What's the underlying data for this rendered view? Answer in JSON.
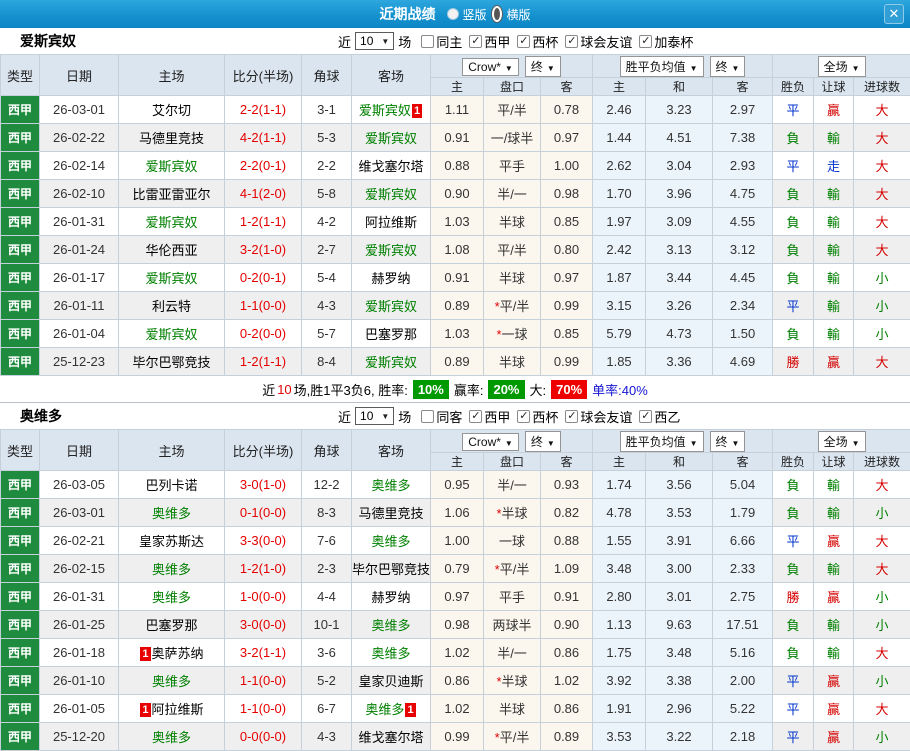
{
  "titlebar": {
    "title": "近期战绩",
    "radios": [
      {
        "label": "竖版",
        "selected": false
      },
      {
        "label": "横版",
        "selected": true
      }
    ],
    "close_glyph": "✕"
  },
  "table_header": {
    "left_cols": [
      "类型",
      "日期",
      "主场",
      "比分(半场)",
      "角球",
      "客场"
    ],
    "groups": [
      {
        "dropdowns": [
          "Crow*",
          "终"
        ],
        "cols": [
          "主",
          "盘口",
          "客"
        ]
      },
      {
        "dropdowns": [
          "胜平负均值",
          "终"
        ],
        "cols": [
          "主",
          "和",
          "客"
        ]
      },
      {
        "dropdowns": [
          "全场"
        ],
        "cols": [
          "胜负",
          "让球",
          "进球数"
        ]
      }
    ],
    "dropdown_arrow": "▼",
    "check_glyph": "✓"
  },
  "sections": [
    {
      "team": "爱斯宾奴",
      "near_label": "近",
      "count_value": "10",
      "count_suffix": "场",
      "filters": [
        {
          "label": "同主",
          "checked": false
        },
        {
          "label": "西甲",
          "checked": true
        },
        {
          "label": "西杯",
          "checked": true
        },
        {
          "label": "球会友谊",
          "checked": true
        },
        {
          "label": "加泰杯",
          "checked": true
        }
      ],
      "rows": [
        {
          "league": "西甲",
          "date": "26-03-01",
          "home": "艾尔切",
          "home_is_team": false,
          "home_badge": "",
          "score": "2-2(1-1)",
          "corners": "3-1",
          "away": "爱斯宾奴",
          "away_is_team": true,
          "away_badge": "1",
          "odds": [
            "1.11",
            "平/半",
            "0.78"
          ],
          "means": [
            "2.46",
            "3.23",
            "2.97"
          ],
          "results": [
            "平",
            "贏",
            "大"
          ]
        },
        {
          "league": "西甲",
          "date": "26-02-22",
          "home": "马德里竞技",
          "home_is_team": false,
          "home_badge": "",
          "score": "4-2(1-1)",
          "corners": "5-3",
          "away": "爱斯宾奴",
          "away_is_team": true,
          "away_badge": "",
          "odds": [
            "0.91",
            "一/球半",
            "0.97"
          ],
          "means": [
            "1.44",
            "4.51",
            "7.38"
          ],
          "results": [
            "負",
            "輸",
            "大"
          ]
        },
        {
          "league": "西甲",
          "date": "26-02-14",
          "home": "爱斯宾奴",
          "home_is_team": true,
          "home_badge": "",
          "score": "2-2(0-1)",
          "corners": "2-2",
          "away": "维戈塞尔塔",
          "away_is_team": false,
          "away_badge": "",
          "odds": [
            "0.88",
            "平手",
            "1.00"
          ],
          "means": [
            "2.62",
            "3.04",
            "2.93"
          ],
          "results": [
            "平",
            "走",
            "大"
          ]
        },
        {
          "league": "西甲",
          "date": "26-02-10",
          "home": "比雷亚雷亚尔",
          "home_is_team": false,
          "home_badge": "",
          "score": "4-1(2-0)",
          "corners": "5-8",
          "away": "爱斯宾奴",
          "away_is_team": true,
          "away_badge": "",
          "odds": [
            "0.90",
            "半/一",
            "0.98"
          ],
          "means": [
            "1.70",
            "3.96",
            "4.75"
          ],
          "results": [
            "負",
            "輸",
            "大"
          ]
        },
        {
          "league": "西甲",
          "date": "26-01-31",
          "home": "爱斯宾奴",
          "home_is_team": true,
          "home_badge": "",
          "score": "1-2(1-1)",
          "corners": "4-2",
          "away": "阿拉维斯",
          "away_is_team": false,
          "away_badge": "",
          "odds": [
            "1.03",
            "半球",
            "0.85"
          ],
          "means": [
            "1.97",
            "3.09",
            "4.55"
          ],
          "results": [
            "負",
            "輸",
            "大"
          ]
        },
        {
          "league": "西甲",
          "date": "26-01-24",
          "home": "华伦西亚",
          "home_is_team": false,
          "home_badge": "",
          "score": "3-2(1-0)",
          "corners": "2-7",
          "away": "爱斯宾奴",
          "away_is_team": true,
          "away_badge": "",
          "odds": [
            "1.08",
            "平/半",
            "0.80"
          ],
          "means": [
            "2.42",
            "3.13",
            "3.12"
          ],
          "results": [
            "負",
            "輸",
            "大"
          ]
        },
        {
          "league": "西甲",
          "date": "26-01-17",
          "home": "爱斯宾奴",
          "home_is_team": true,
          "home_badge": "",
          "score": "0-2(0-1)",
          "corners": "5-4",
          "away": "赫罗纳",
          "away_is_team": false,
          "away_badge": "",
          "odds": [
            "0.91",
            "半球",
            "0.97"
          ],
          "means": [
            "1.87",
            "3.44",
            "4.45"
          ],
          "results": [
            "負",
            "輸",
            "小"
          ]
        },
        {
          "league": "西甲",
          "date": "26-01-11",
          "home": "利云特",
          "home_is_team": false,
          "home_badge": "",
          "score": "1-1(0-0)",
          "corners": "4-3",
          "away": "爱斯宾奴",
          "away_is_team": true,
          "away_badge": "",
          "odds": [
            "0.89",
            "*平/半",
            "0.99"
          ],
          "means": [
            "3.15",
            "3.26",
            "2.34"
          ],
          "results": [
            "平",
            "輸",
            "小"
          ]
        },
        {
          "league": "西甲",
          "date": "26-01-04",
          "home": "爱斯宾奴",
          "home_is_team": true,
          "home_badge": "",
          "score": "0-2(0-0)",
          "corners": "5-7",
          "away": "巴塞罗那",
          "away_is_team": false,
          "away_badge": "",
          "odds": [
            "1.03",
            "*一球",
            "0.85"
          ],
          "means": [
            "5.79",
            "4.73",
            "1.50"
          ],
          "results": [
            "負",
            "輸",
            "小"
          ]
        },
        {
          "league": "西甲",
          "date": "25-12-23",
          "home": "毕尔巴鄂竞技",
          "home_is_team": false,
          "home_badge": "",
          "score": "1-2(1-1)",
          "corners": "8-4",
          "away": "爱斯宾奴",
          "away_is_team": true,
          "away_badge": "",
          "odds": [
            "0.89",
            "半球",
            "0.99"
          ],
          "means": [
            "1.85",
            "3.36",
            "4.69"
          ],
          "results": [
            "勝",
            "贏",
            "大"
          ]
        }
      ],
      "summary": [
        {
          "t": "近",
          "s": "plain"
        },
        {
          "t": "10",
          "s": "red"
        },
        {
          "t": "场,胜1平3负6, 胜率:",
          "s": "plain"
        },
        {
          "t": "10%",
          "s": "badge-green"
        },
        {
          "t": "赢率:",
          "s": "plain"
        },
        {
          "t": "20%",
          "s": "badge-green"
        },
        {
          "t": "大:",
          "s": "plain"
        },
        {
          "t": "70%",
          "s": "badge-red"
        },
        {
          "t": "单率:40%",
          "s": "blue"
        }
      ]
    },
    {
      "team": "奥维多",
      "near_label": "近",
      "count_value": "10",
      "count_suffix": "场",
      "filters": [
        {
          "label": "同客",
          "checked": false
        },
        {
          "label": "西甲",
          "checked": true
        },
        {
          "label": "西杯",
          "checked": true
        },
        {
          "label": "球会友谊",
          "checked": true
        },
        {
          "label": "西乙",
          "checked": true
        }
      ],
      "rows": [
        {
          "league": "西甲",
          "date": "26-03-05",
          "home": "巴列卡诺",
          "home_is_team": false,
          "home_badge": "",
          "score": "3-0(1-0)",
          "corners": "12-2",
          "away": "奥维多",
          "away_is_team": true,
          "away_badge": "",
          "odds": [
            "0.95",
            "半/一",
            "0.93"
          ],
          "means": [
            "1.74",
            "3.56",
            "5.04"
          ],
          "results": [
            "負",
            "輸",
            "大"
          ]
        },
        {
          "league": "西甲",
          "date": "26-03-01",
          "home": "奥维多",
          "home_is_team": true,
          "home_badge": "",
          "score": "0-1(0-0)",
          "corners": "8-3",
          "away": "马德里竞技",
          "away_is_team": false,
          "away_badge": "",
          "odds": [
            "1.06",
            "*半球",
            "0.82"
          ],
          "means": [
            "4.78",
            "3.53",
            "1.79"
          ],
          "results": [
            "負",
            "輸",
            "小"
          ]
        },
        {
          "league": "西甲",
          "date": "26-02-21",
          "home": "皇家苏斯达",
          "home_is_team": false,
          "home_badge": "",
          "score": "3-3(0-0)",
          "corners": "7-6",
          "away": "奥维多",
          "away_is_team": true,
          "away_badge": "",
          "odds": [
            "1.00",
            "一球",
            "0.88"
          ],
          "means": [
            "1.55",
            "3.91",
            "6.66"
          ],
          "results": [
            "平",
            "贏",
            "大"
          ]
        },
        {
          "league": "西甲",
          "date": "26-02-15",
          "home": "奥维多",
          "home_is_team": true,
          "home_badge": "",
          "score": "1-2(1-0)",
          "corners": "2-3",
          "away": "毕尔巴鄂竞技",
          "away_is_team": false,
          "away_badge": "",
          "odds": [
            "0.79",
            "*平/半",
            "1.09"
          ],
          "means": [
            "3.48",
            "3.00",
            "2.33"
          ],
          "results": [
            "負",
            "輸",
            "大"
          ]
        },
        {
          "league": "西甲",
          "date": "26-01-31",
          "home": "奥维多",
          "home_is_team": true,
          "home_badge": "",
          "score": "1-0(0-0)",
          "corners": "4-4",
          "away": "赫罗纳",
          "away_is_team": false,
          "away_badge": "",
          "odds": [
            "0.97",
            "平手",
            "0.91"
          ],
          "means": [
            "2.80",
            "3.01",
            "2.75"
          ],
          "results": [
            "勝",
            "贏",
            "小"
          ]
        },
        {
          "league": "西甲",
          "date": "26-01-25",
          "home": "巴塞罗那",
          "home_is_team": false,
          "home_badge": "",
          "score": "3-0(0-0)",
          "corners": "10-1",
          "away": "奥维多",
          "away_is_team": true,
          "away_badge": "",
          "odds": [
            "0.98",
            "两球半",
            "0.90"
          ],
          "means": [
            "1.13",
            "9.63",
            "17.51"
          ],
          "results": [
            "負",
            "輸",
            "小"
          ]
        },
        {
          "league": "西甲",
          "date": "26-01-18",
          "home": "奥萨苏纳",
          "home_is_team": false,
          "home_badge": "1",
          "score": "3-2(1-1)",
          "corners": "3-6",
          "away": "奥维多",
          "away_is_team": true,
          "away_badge": "",
          "odds": [
            "1.02",
            "半/一",
            "0.86"
          ],
          "means": [
            "1.75",
            "3.48",
            "5.16"
          ],
          "results": [
            "負",
            "輸",
            "大"
          ]
        },
        {
          "league": "西甲",
          "date": "26-01-10",
          "home": "奥维多",
          "home_is_team": true,
          "home_badge": "",
          "score": "1-1(0-0)",
          "corners": "5-2",
          "away": "皇家贝迪斯",
          "away_is_team": false,
          "away_badge": "",
          "odds": [
            "0.86",
            "*半球",
            "1.02"
          ],
          "means": [
            "3.92",
            "3.38",
            "2.00"
          ],
          "results": [
            "平",
            "贏",
            "小"
          ]
        },
        {
          "league": "西甲",
          "date": "26-01-05",
          "home": "阿拉维斯",
          "home_is_team": false,
          "home_badge": "1",
          "score": "1-1(0-0)",
          "corners": "6-7",
          "away": "奥维多",
          "away_is_team": true,
          "away_badge": "1",
          "odds": [
            "1.02",
            "半球",
            "0.86"
          ],
          "means": [
            "1.91",
            "2.96",
            "5.22"
          ],
          "results": [
            "平",
            "贏",
            "大"
          ]
        },
        {
          "league": "西甲",
          "date": "25-12-20",
          "home": "奥维多",
          "home_is_team": true,
          "home_badge": "",
          "score": "0-0(0-0)",
          "corners": "4-3",
          "away": "维戈塞尔塔",
          "away_is_team": false,
          "away_badge": "",
          "odds": [
            "0.99",
            "*平/半",
            "0.89"
          ],
          "means": [
            "3.53",
            "3.22",
            "2.18"
          ],
          "results": [
            "平",
            "贏",
            "小"
          ]
        }
      ],
      "summary": null
    }
  ]
}
